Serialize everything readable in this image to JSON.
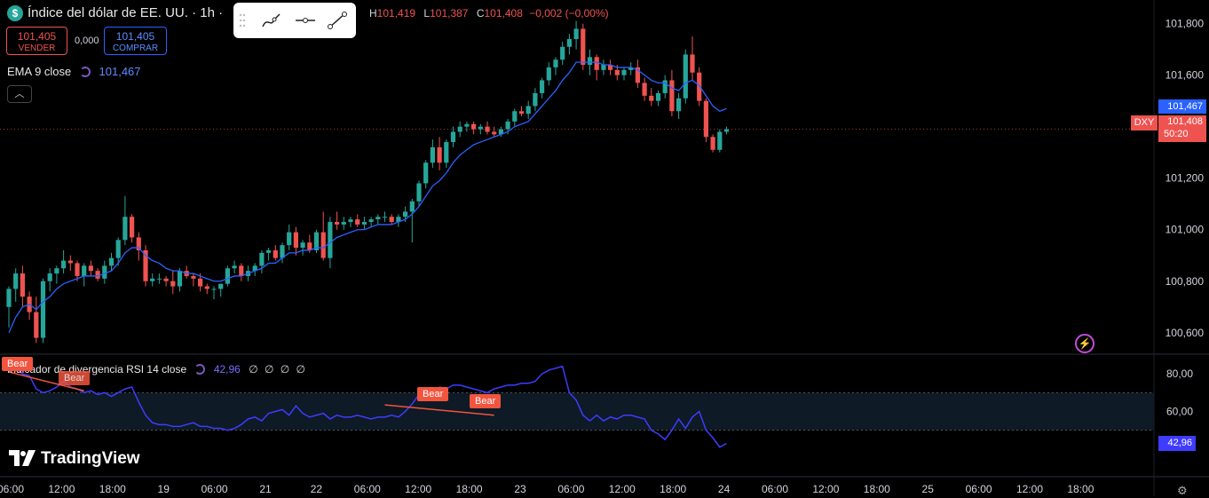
{
  "header": {
    "symbol_icon": "$",
    "title": "Índice del dólar de EE. UU. · 1h ·",
    "ohlc": {
      "h_label": "H",
      "h": "101,419",
      "l_label": "L",
      "l": "101,387",
      "c_label": "C",
      "c": "101,408",
      "change": "−0,002 (−0,00%)"
    },
    "toolbar_icons": [
      "drag-handle-icon",
      "curve-tool-icon",
      "horizontal-line-tool-icon",
      "trend-line-tool-icon"
    ]
  },
  "trade": {
    "sell_price": "101,405",
    "sell_label": "VENDER",
    "spread": "0,000",
    "buy_price": "101,405",
    "buy_label": "COMPRAR"
  },
  "ema_legend": {
    "label": "EMA 9 close",
    "value": "101,467"
  },
  "rsi_legend": {
    "label": "Indicador de divergencia RSI 14 close",
    "value": "42,96",
    "dots": "∅ ∅ ∅ ∅"
  },
  "price_axis": {
    "ticks": [
      "101,800",
      "101,600",
      "101,400",
      "101,200",
      "101,000",
      "100,800",
      "100,600"
    ],
    "ema_tag": "101,467",
    "last_price_tag": "101,408",
    "countdown": "50:20",
    "symbol_tag": "DXY"
  },
  "rsi_axis": {
    "ticks": [
      "80,00",
      "60,00"
    ],
    "value_tag": "42,96"
  },
  "time_axis": [
    "06:00",
    "12:00",
    "18:00",
    "19",
    "06:00",
    "21",
    "22",
    "06:00",
    "12:00",
    "18:00",
    "23",
    "06:00",
    "12:00",
    "18:00",
    "24",
    "06:00",
    "12:00",
    "18:00",
    "25",
    "06:00",
    "12:00",
    "18:00"
  ],
  "divergence_labels": [
    "Bear",
    "Bear",
    "Bear",
    "Bear"
  ],
  "brand": "TradingView",
  "colors": {
    "up": "#26a69a",
    "down": "#ef5350",
    "ema": "#2962ff",
    "rsi": "#3f3bff",
    "divergence": "#f2543d",
    "background": "#000000",
    "rsi_band": "#0e1a26"
  },
  "chart_data": [
    {
      "type": "candlestick",
      "ylim": [
        100.52,
        101.84
      ],
      "candles": [
        [
          100.7,
          100.78,
          100.62,
          100.77
        ],
        [
          100.77,
          100.85,
          100.72,
          100.83
        ],
        [
          100.83,
          100.86,
          100.7,
          100.74
        ],
        [
          100.74,
          100.76,
          100.65,
          100.68
        ],
        [
          100.68,
          100.74,
          100.56,
          100.58
        ],
        [
          100.58,
          100.81,
          100.56,
          100.8
        ],
        [
          100.8,
          100.85,
          100.76,
          100.83
        ],
        [
          100.83,
          100.86,
          100.79,
          100.85
        ],
        [
          100.85,
          100.92,
          100.83,
          100.88
        ],
        [
          100.88,
          100.9,
          100.84,
          100.87
        ],
        [
          100.87,
          100.88,
          100.8,
          100.82
        ],
        [
          100.82,
          100.87,
          100.78,
          100.86
        ],
        [
          100.86,
          100.88,
          100.82,
          100.84
        ],
        [
          100.84,
          100.85,
          100.8,
          100.81
        ],
        [
          100.81,
          100.88,
          100.79,
          100.86
        ],
        [
          100.86,
          100.91,
          100.84,
          100.89
        ],
        [
          100.89,
          100.97,
          100.86,
          100.96
        ],
        [
          100.96,
          101.13,
          100.94,
          101.05
        ],
        [
          101.05,
          101.06,
          100.95,
          100.97
        ],
        [
          100.97,
          100.99,
          100.88,
          100.92
        ],
        [
          100.92,
          100.94,
          100.78,
          100.8
        ],
        [
          100.8,
          100.83,
          100.78,
          100.81
        ],
        [
          100.81,
          100.83,
          100.79,
          100.81
        ],
        [
          100.81,
          100.82,
          100.78,
          100.8
        ],
        [
          100.8,
          100.84,
          100.75,
          100.78
        ],
        [
          100.78,
          100.85,
          100.76,
          100.84
        ],
        [
          100.84,
          100.86,
          100.81,
          100.82
        ],
        [
          100.82,
          100.83,
          100.78,
          100.81
        ],
        [
          100.81,
          100.83,
          100.76,
          100.78
        ],
        [
          100.78,
          100.79,
          100.75,
          100.77
        ],
        [
          100.77,
          100.78,
          100.73,
          100.77
        ],
        [
          100.77,
          100.79,
          100.74,
          100.79
        ],
        [
          100.79,
          100.86,
          100.78,
          100.85
        ],
        [
          100.85,
          100.88,
          100.83,
          100.86
        ],
        [
          100.86,
          100.87,
          100.8,
          100.82
        ],
        [
          100.82,
          100.86,
          100.8,
          100.84
        ],
        [
          100.84,
          100.87,
          100.82,
          100.86
        ],
        [
          100.86,
          100.92,
          100.83,
          100.91
        ],
        [
          100.91,
          100.93,
          100.88,
          100.92
        ],
        [
          100.92,
          100.94,
          100.88,
          100.89
        ],
        [
          100.89,
          100.95,
          100.87,
          100.94
        ],
        [
          100.94,
          101.02,
          100.92,
          100.99
        ],
        [
          100.99,
          101.01,
          100.9,
          100.93
        ],
        [
          100.93,
          100.96,
          100.9,
          100.95
        ],
        [
          100.95,
          100.98,
          100.91,
          100.92
        ],
        [
          100.92,
          101.0,
          100.91,
          100.99
        ],
        [
          100.99,
          101.07,
          100.88,
          100.89
        ],
        [
          100.89,
          101.05,
          100.85,
          101.03
        ],
        [
          101.03,
          101.07,
          101.0,
          101.02
        ],
        [
          101.02,
          101.05,
          101.0,
          101.03
        ],
        [
          101.03,
          101.05,
          101.01,
          101.04
        ],
        [
          101.04,
          101.06,
          101.01,
          101.02
        ],
        [
          101.02,
          101.05,
          101.0,
          101.03
        ],
        [
          101.03,
          101.05,
          101.01,
          101.04
        ],
        [
          101.04,
          101.06,
          101.02,
          101.05
        ],
        [
          101.05,
          101.07,
          101.03,
          101.05
        ],
        [
          101.05,
          101.06,
          101.02,
          101.03
        ],
        [
          101.03,
          101.06,
          101.01,
          101.05
        ],
        [
          101.05,
          101.09,
          101.03,
          101.07
        ],
        [
          101.07,
          101.12,
          100.95,
          101.11
        ],
        [
          101.11,
          101.19,
          101.09,
          101.18
        ],
        [
          101.18,
          101.27,
          101.16,
          101.26
        ],
        [
          101.26,
          101.35,
          101.24,
          101.32
        ],
        [
          101.32,
          101.36,
          101.23,
          101.26
        ],
        [
          101.26,
          101.35,
          101.24,
          101.34
        ],
        [
          101.34,
          101.4,
          101.32,
          101.38
        ],
        [
          101.38,
          101.42,
          101.36,
          101.4
        ],
        [
          101.4,
          101.42,
          101.38,
          101.41
        ],
        [
          101.41,
          101.42,
          101.37,
          101.39
        ],
        [
          101.39,
          101.41,
          101.37,
          101.4
        ],
        [
          101.4,
          101.42,
          101.37,
          101.38
        ],
        [
          101.38,
          101.4,
          101.36,
          101.37
        ],
        [
          101.37,
          101.4,
          101.36,
          101.39
        ],
        [
          101.39,
          101.43,
          101.37,
          101.42
        ],
        [
          101.42,
          101.47,
          101.4,
          101.46
        ],
        [
          101.46,
          101.48,
          101.44,
          101.45
        ],
        [
          101.45,
          101.5,
          101.43,
          101.48
        ],
        [
          101.48,
          101.55,
          101.46,
          101.53
        ],
        [
          101.53,
          101.59,
          101.51,
          101.58
        ],
        [
          101.58,
          101.65,
          101.56,
          101.63
        ],
        [
          101.63,
          101.67,
          101.6,
          101.66
        ],
        [
          101.66,
          101.73,
          101.64,
          101.71
        ],
        [
          101.71,
          101.76,
          101.68,
          101.74
        ],
        [
          101.74,
          101.81,
          101.7,
          101.78
        ],
        [
          101.78,
          101.8,
          101.62,
          101.64
        ],
        [
          101.64,
          101.7,
          101.6,
          101.67
        ],
        [
          101.67,
          101.68,
          101.58,
          101.62
        ],
        [
          101.62,
          101.66,
          101.6,
          101.64
        ],
        [
          101.64,
          101.66,
          101.6,
          101.62
        ],
        [
          101.62,
          101.64,
          101.58,
          101.6
        ],
        [
          101.6,
          101.63,
          101.58,
          101.62
        ],
        [
          101.62,
          101.65,
          101.6,
          101.63
        ],
        [
          101.63,
          101.66,
          101.55,
          101.57
        ],
        [
          101.57,
          101.59,
          101.5,
          101.52
        ],
        [
          101.52,
          101.55,
          101.48,
          101.5
        ],
        [
          101.5,
          101.54,
          101.48,
          101.53
        ],
        [
          101.53,
          101.6,
          101.51,
          101.58
        ],
        [
          101.58,
          101.62,
          101.44,
          101.46
        ],
        [
          101.46,
          101.53,
          101.43,
          101.51
        ],
        [
          101.51,
          101.7,
          101.49,
          101.68
        ],
        [
          101.68,
          101.75,
          101.58,
          101.61
        ],
        [
          101.61,
          101.63,
          101.48,
          101.5
        ],
        [
          101.5,
          101.51,
          101.34,
          101.36
        ],
        [
          101.36,
          101.37,
          101.3,
          101.31
        ],
        [
          101.31,
          101.39,
          101.3,
          101.38
        ],
        [
          101.38,
          101.4,
          101.37,
          101.39
        ]
      ],
      "ema9": [
        100.6,
        100.66,
        100.7,
        100.71,
        100.69,
        100.72,
        100.74,
        100.77,
        100.79,
        100.8,
        100.81,
        100.82,
        100.82,
        100.82,
        100.83,
        100.84,
        100.87,
        100.91,
        100.93,
        100.93,
        100.9,
        100.88,
        100.87,
        100.85,
        100.84,
        100.84,
        100.83,
        100.83,
        100.82,
        100.81,
        100.8,
        100.8,
        100.81,
        100.82,
        100.82,
        100.83,
        100.84,
        100.85,
        100.87,
        100.87,
        100.89,
        100.91,
        100.91,
        100.92,
        100.92,
        100.93,
        100.93,
        100.95,
        100.97,
        100.98,
        100.99,
        101.0,
        101.0,
        101.01,
        101.02,
        101.02,
        101.02,
        101.03,
        101.04,
        101.06,
        101.09,
        101.13,
        101.17,
        101.19,
        101.22,
        101.26,
        101.29,
        101.31,
        101.33,
        101.34,
        101.35,
        101.36,
        101.37,
        101.38,
        101.4,
        101.41,
        101.42,
        101.45,
        101.48,
        101.51,
        101.54,
        101.58,
        101.61,
        101.65,
        101.65,
        101.65,
        101.65,
        101.64,
        101.64,
        101.63,
        101.63,
        101.63,
        101.62,
        101.6,
        101.58,
        101.57,
        101.57,
        101.55,
        101.54,
        101.57,
        101.58,
        101.56,
        101.52,
        101.48,
        101.46,
        101.47
      ]
    },
    {
      "type": "line",
      "series": [
        {
          "name": "RSI 14",
          "values": [
            81,
            83,
            80,
            79,
            72,
            70,
            71,
            73,
            76,
            73,
            72,
            70,
            71,
            69,
            70,
            68,
            70,
            72,
            73,
            65,
            58,
            54,
            53,
            53,
            52,
            52,
            53,
            54,
            52,
            52,
            51,
            51,
            50,
            51,
            53,
            56,
            57,
            55,
            59,
            60,
            61,
            58,
            63,
            59,
            57,
            58,
            59,
            56,
            58,
            57,
            57,
            58,
            57,
            56,
            57,
            57,
            58,
            57,
            60,
            64,
            69,
            72,
            70,
            73,
            72,
            74,
            74,
            73,
            72,
            71,
            70,
            72,
            73,
            74,
            74,
            75,
            75,
            76,
            80,
            82,
            83,
            84,
            70,
            66,
            58,
            55,
            58,
            55,
            57,
            56,
            58,
            58,
            57,
            56,
            50,
            48,
            45,
            50,
            56,
            51,
            57,
            60,
            50,
            46,
            41,
            43
          ]
        }
      ],
      "ylim": [
        30,
        90
      ],
      "overbought": 70,
      "oversold": 30
    }
  ]
}
